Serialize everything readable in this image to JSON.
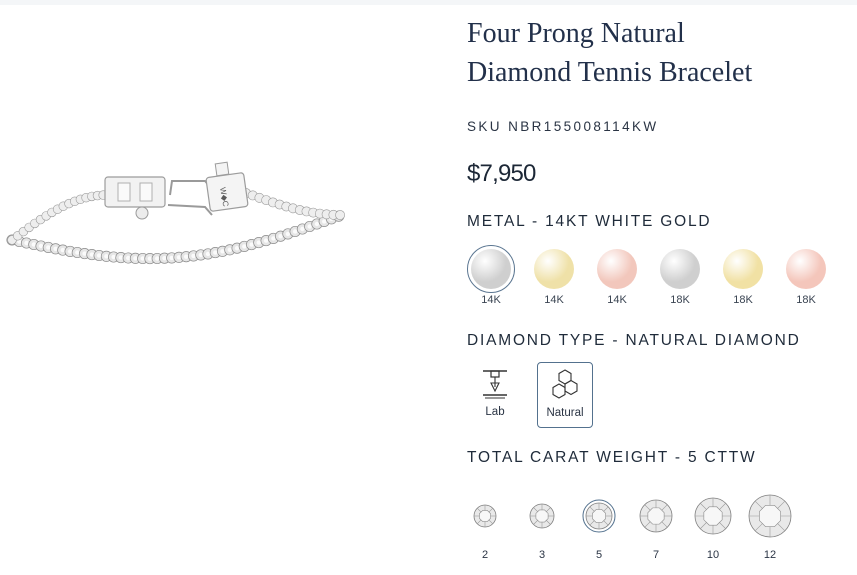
{
  "product": {
    "title_line1": "Four Prong Natural",
    "title_line2": "Diamond Tennis Bracelet",
    "sku": "SKU NBR155008114KW",
    "price": "$7,950"
  },
  "metal": {
    "heading": "METAL - 14KT WHITE GOLD",
    "options": [
      {
        "label": "14K",
        "color": "#cfcfcf",
        "selected": true
      },
      {
        "label": "14K",
        "color": "#efe1a8",
        "selected": false
      },
      {
        "label": "14K",
        "color": "#f2c7bc",
        "selected": false
      },
      {
        "label": "18K",
        "color": "#cfcfcf",
        "selected": false
      },
      {
        "label": "18K",
        "color": "#f1e1a4",
        "selected": false
      },
      {
        "label": "18K",
        "color": "#f4c6bb",
        "selected": false
      }
    ]
  },
  "diamond_type": {
    "heading": "DIAMOND TYPE - NATURAL DIAMOND",
    "options": [
      {
        "label": "Lab",
        "icon": "lab-grown-icon",
        "selected": false
      },
      {
        "label": "Natural",
        "icon": "natural-mineral-icon",
        "selected": true
      }
    ]
  },
  "carat": {
    "heading": "TOTAL CARAT WEIGHT - 5 CTTW",
    "options": [
      {
        "label": "2",
        "selected": false
      },
      {
        "label": "3",
        "selected": false
      },
      {
        "label": "5",
        "selected": true
      },
      {
        "label": "7",
        "selected": false
      },
      {
        "label": "10",
        "selected": false
      },
      {
        "label": "12",
        "selected": false
      }
    ]
  },
  "colors": {
    "heading": "#1f2b3a",
    "selected_border": "#53718e"
  },
  "image": {
    "clasp_engraving": "W◆C"
  }
}
